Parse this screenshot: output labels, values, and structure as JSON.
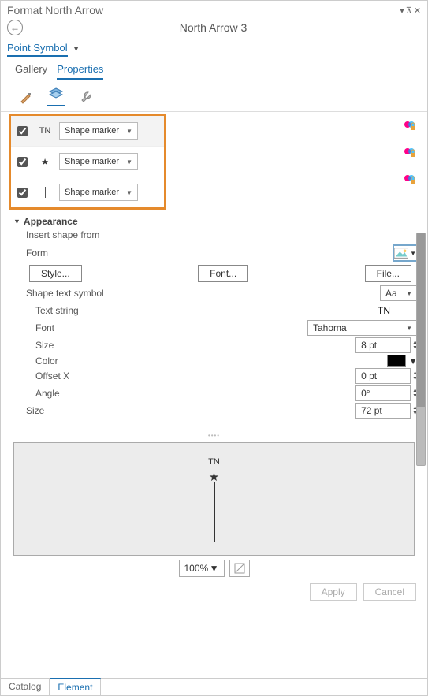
{
  "pane": {
    "title": "Format North Arrow",
    "subtitle": "North Arrow 3"
  },
  "breadcrumb": {
    "label": "Point Symbol"
  },
  "tabs": {
    "gallery": "Gallery",
    "properties": "Properties",
    "active": "properties"
  },
  "layers": {
    "items": [
      {
        "icon_text": "TN",
        "icon_kind": "text",
        "marker": "Shape marker",
        "checked": true
      },
      {
        "icon_text": "",
        "icon_kind": "star",
        "marker": "Shape marker",
        "checked": true
      },
      {
        "icon_text": "",
        "icon_kind": "line",
        "marker": "Shape marker",
        "checked": true
      }
    ]
  },
  "appearance": {
    "header": "Appearance",
    "insert_label": "Insert shape from",
    "form_label": "Form",
    "style_btn": "Style...",
    "font_btn": "Font...",
    "file_btn": "File...",
    "shape_text_symbol_label": "Shape text symbol",
    "shape_text_symbol_value": "Aa",
    "text_string_label": "Text string",
    "text_string_value": "TN",
    "font_label": "Font",
    "font_value": "Tahoma",
    "size_inner_label": "Size",
    "size_inner_value": "8 pt",
    "color_label": "Color",
    "offsetx_label": "Offset X",
    "offsetx_value": "0 pt",
    "angle_label": "Angle",
    "angle_value": "0°",
    "size_outer_label": "Size",
    "size_outer_value": "72 pt"
  },
  "preview": {
    "tn": "TN"
  },
  "zoom": {
    "value": "100%"
  },
  "footer": {
    "apply": "Apply",
    "cancel": "Cancel"
  },
  "bottom_tabs": {
    "catalog": "Catalog",
    "element": "Element"
  }
}
